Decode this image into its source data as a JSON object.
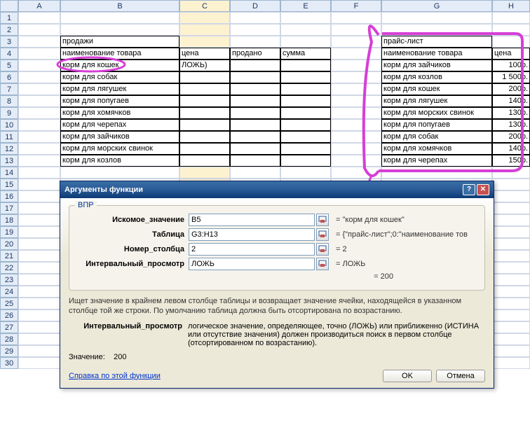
{
  "cols": [
    "A",
    "B",
    "C",
    "D",
    "E",
    "F",
    "G",
    "H"
  ],
  "rows": 30,
  "leftTable": {
    "title": "продажи",
    "headers": [
      "наименование товара",
      "цена",
      "продано",
      "сумма"
    ],
    "items": [
      {
        "name": "корм для кошек",
        "price": "ЛОЖЬ)"
      },
      {
        "name": "корм для собак",
        "price": ""
      },
      {
        "name": "корм для лягушек",
        "price": ""
      },
      {
        "name": "корм для попугаев",
        "price": ""
      },
      {
        "name": "корм для хомячков",
        "price": ""
      },
      {
        "name": "корм для черепах",
        "price": ""
      },
      {
        "name": "корм для зайчиков",
        "price": ""
      },
      {
        "name": "корм для морских свинок",
        "price": ""
      },
      {
        "name": "корм для козлов",
        "price": ""
      }
    ]
  },
  "rightTable": {
    "title": "прайс-лист",
    "headers": [
      "наименование товара",
      "цена"
    ],
    "items": [
      {
        "name": "корм для зайчиков",
        "price": "100р."
      },
      {
        "name": "корм для козлов",
        "price": "1 500р."
      },
      {
        "name": "корм для кошек",
        "price": "200р."
      },
      {
        "name": "корм для лягушек",
        "price": "140р."
      },
      {
        "name": "корм для морских свинок",
        "price": "130р."
      },
      {
        "name": "корм для попугаев",
        "price": "130р."
      },
      {
        "name": "корм для собак",
        "price": "200р."
      },
      {
        "name": "корм для хомячков",
        "price": "140р."
      },
      {
        "name": "корм для черепах",
        "price": "150р."
      }
    ]
  },
  "dialog": {
    "title": "Аргументы функции",
    "funcName": "ВПР",
    "args": [
      {
        "label": "Искомое_значение",
        "value": "B5",
        "eval": "= \"корм для кошек\""
      },
      {
        "label": "Таблица",
        "value": "G3:H13",
        "eval": "= {\"прайс-лист\";0:\"наименование тов"
      },
      {
        "label": "Номер_столбца",
        "value": "2",
        "eval": "= 2"
      },
      {
        "label": "Интервальный_просмотр",
        "value": "ЛОЖЬ",
        "eval": "= ЛОЖЬ"
      }
    ],
    "resultEval": "= 200",
    "description": "Ищет значение в крайнем левом столбце таблицы и возвращает значение ячейки, находящейся в указанном столбце той же строки. По умолчанию таблица должна быть отсортирована по возрастанию.",
    "argDescLabel": "Интервальный_просмотр",
    "argDescText": "логическое значение, определяющее, точно (ЛОЖЬ) или приближенно (ИСТИНА или отсутствие значения) должен производиться поиск в первом столбце (отсортированном по возрастанию).",
    "resultLabel": "Значение:",
    "resultValue": "200",
    "helpLink": "Справка по этой функции",
    "ok": "OK",
    "cancel": "Отмена"
  }
}
